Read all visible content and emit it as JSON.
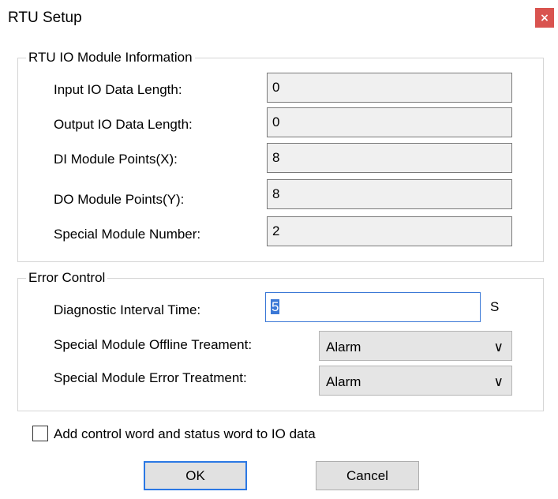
{
  "window": {
    "title": "RTU Setup",
    "close_glyph": "×"
  },
  "io_group": {
    "legend": "RTU IO Module Information",
    "fields": [
      {
        "label": "Input IO Data Length:",
        "value": "0"
      },
      {
        "label": "Output IO Data Length:",
        "value": "0"
      },
      {
        "label": "DI Module Points(X):",
        "value": "8"
      },
      {
        "label": "DO Module Points(Y):",
        "value": "8"
      },
      {
        "label": "Special Module Number:",
        "value": "2"
      }
    ]
  },
  "error_group": {
    "legend": "Error Control",
    "diagnostic_label": "Diagnostic Interval Time:",
    "diagnostic_value": "5",
    "diagnostic_unit": "S",
    "offline_label": "Special Module Offline Treament:",
    "offline_value": "Alarm",
    "error_label": "Special Module Error Treatment:",
    "error_value": "Alarm"
  },
  "checkbox": {
    "label": "Add control word and status word to IO data",
    "checked": false
  },
  "buttons": {
    "ok": "OK",
    "cancel": "Cancel"
  },
  "icons": {
    "close": "close-icon",
    "dropdown": "chevron-down-icon",
    "chevron_glyph": "∨"
  }
}
